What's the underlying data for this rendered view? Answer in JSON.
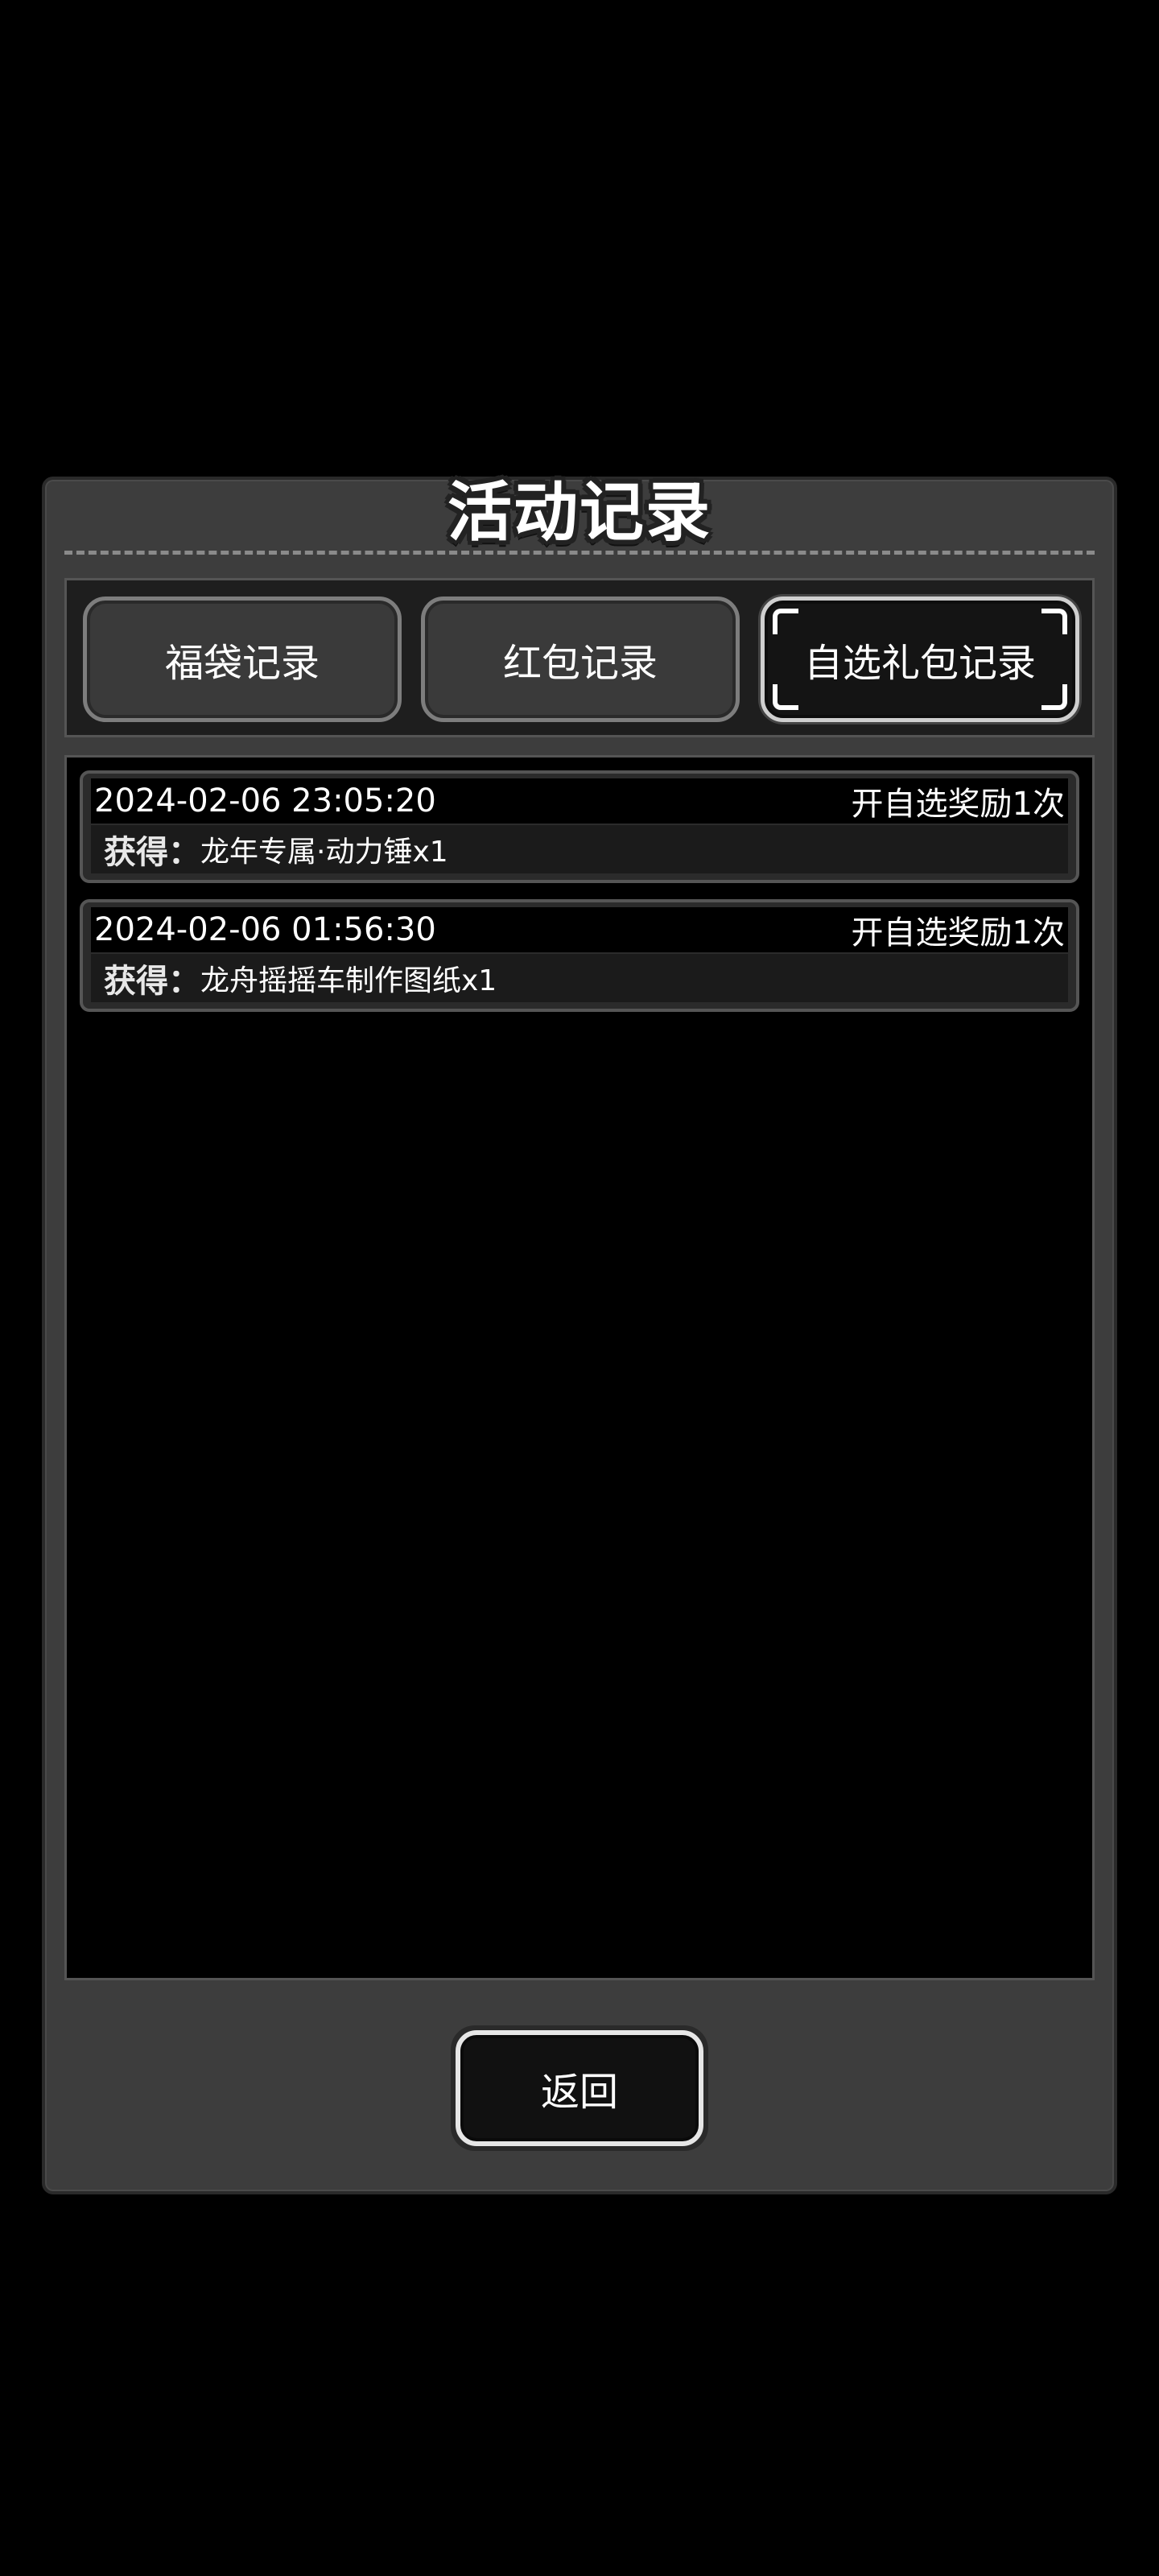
{
  "dialog": {
    "title": "活动记录"
  },
  "tabs": [
    {
      "label": "福袋记录",
      "active": false
    },
    {
      "label": "红包记录",
      "active": false
    },
    {
      "label": "自选礼包记录",
      "active": true
    }
  ],
  "records": [
    {
      "time": "2024-02-06 23:05:20",
      "type": "开自选奖励1次",
      "label": "获得：",
      "item": "龙年专属·动力锤x1"
    },
    {
      "time": "2024-02-06 01:56:30",
      "type": "开自选奖励1次",
      "label": "获得：",
      "item": "龙舟摇摇车制作图纸x1"
    }
  ],
  "footer": {
    "back_label": "返回"
  }
}
